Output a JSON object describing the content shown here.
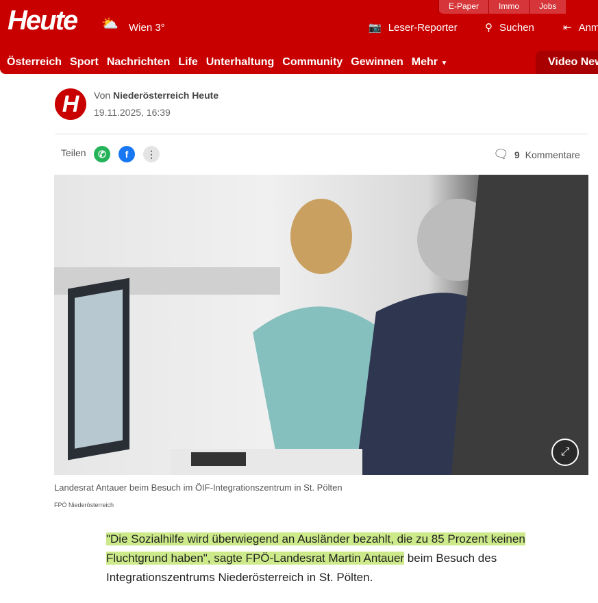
{
  "header": {
    "logo": "Heute",
    "weather": "Wien 3°",
    "weather_icon": "sun-cloud-icon",
    "top_links": [
      "E-Paper",
      "Immo",
      "Jobs"
    ],
    "actions": [
      {
        "label": "Leser-Reporter",
        "icon": "camera-icon"
      },
      {
        "label": "Suchen",
        "icon": "search-icon"
      },
      {
        "label": "Anmelden",
        "icon": "login-icon"
      }
    ],
    "nav": [
      "Österreich",
      "Sport",
      "Nachrichten",
      "Life",
      "Unterhaltung",
      "Community",
      "Gewinnen"
    ],
    "more": "Mehr",
    "video": "Video",
    "news": "News"
  },
  "article": {
    "author_prefix": "Von",
    "author": "Niederösterreich Heute",
    "avatar_letter": "H",
    "date": "19.11.2025, 16:39",
    "share_label": "Teilen",
    "comment_count": "9",
    "comments_label": "Kommentare",
    "caption": "Landesrat Antauer beim Besuch im ÖIF-Integrationszentrum in St. Pölten",
    "credit": "FPÖ Niederösterreich",
    "quote_highlighted": "\"Die Sozialhilfe wird überwiegend an Ausländer bezahlt, die zu 85 Prozent keinen Fluchtgrund haben\", sagte FPÖ-Landesrat Martin Antauer",
    "quote_rest": " beim Besuch des Integrationszentrums Niederösterreich in St. Pölten."
  },
  "colors": {
    "brand": "#c80000",
    "highlight": "#aadc3c"
  }
}
